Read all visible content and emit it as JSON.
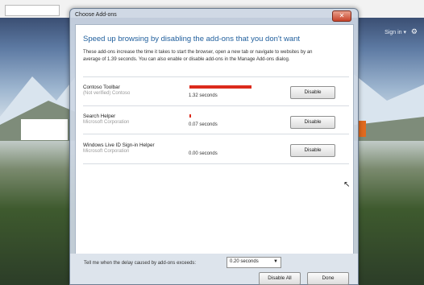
{
  "background": {
    "signin": "Sign in ▾",
    "gear": "⚙"
  },
  "dialog": {
    "title": "Choose Add-ons",
    "close_glyph": "✕",
    "headline": "Speed up browsing by disabling the add-ons that you don't want",
    "intro": "These add-ons increase the time it takes to start the browser, open a new tab or navigate to websites by an average of 1.39 seconds. You can also enable or disable add-ons in the Manage Add-ons dialog.",
    "addons": [
      {
        "name": "Contoso Toolbar",
        "publisher": "(Not verified) Contoso",
        "time": "1.32 seconds",
        "load_fraction": 0.96,
        "button": "Disable"
      },
      {
        "name": "Search Helper",
        "publisher": "Microsoft Corporation",
        "time": "0.07 seconds",
        "load_fraction": 0.02,
        "button": "Disable"
      },
      {
        "name": "Windows Live ID Sign-in Helper",
        "publisher": "Microsoft Corporation",
        "time": "0.00 seconds",
        "load_fraction": 0,
        "button": "Disable"
      }
    ],
    "footer": {
      "label": "Tell me when the delay caused by add-ons exceeds:",
      "select_value": "0.20 seconds",
      "disable_all": "Disable All",
      "done": "Done"
    },
    "colors": {
      "headline": "#1f5e9c",
      "load_bar": "#dc2a1c"
    }
  }
}
